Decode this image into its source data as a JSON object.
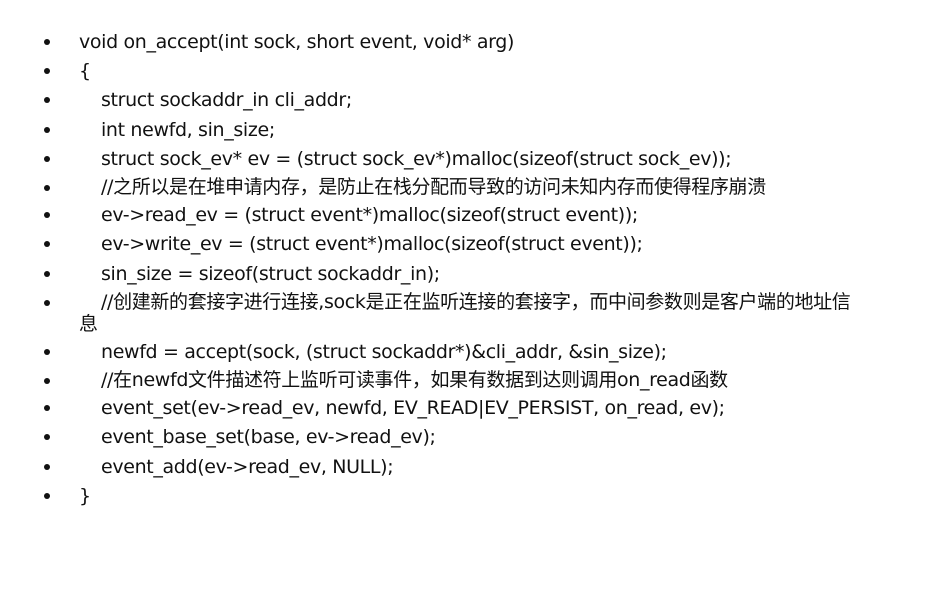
{
  "code_lines": [
    {
      "text": "void on_accept(int sock, short event, void* arg)",
      "indent": false,
      "wrap": false
    },
    {
      "text": "{",
      "indent": false,
      "wrap": false
    },
    {
      "text": "struct sockaddr_in cli_addr;",
      "indent": true,
      "wrap": false
    },
    {
      "text": "int newfd, sin_size;",
      "indent": true,
      "wrap": false
    },
    {
      "text": "struct sock_ev* ev = (struct sock_ev*)malloc(sizeof(struct sock_ev));",
      "indent": true,
      "wrap": false
    },
    {
      "text": "//之所以是在堆申请内存，是防止在栈分配而导致的访问未知内存而使得程序崩溃",
      "indent": true,
      "wrap": true
    },
    {
      "text": "ev->read_ev = (struct event*)malloc(sizeof(struct event));",
      "indent": true,
      "wrap": false
    },
    {
      "text": "ev->write_ev = (struct event*)malloc(sizeof(struct event));",
      "indent": true,
      "wrap": false
    },
    {
      "text": "sin_size = sizeof(struct sockaddr_in);",
      "indent": true,
      "wrap": false
    },
    {
      "text": "//创建新的套接字进行连接,sock是正在监听连接的套接字，而中间参数则是客户端的地址信息",
      "indent": true,
      "wrap": true
    },
    {
      "text": "newfd = accept(sock, (struct sockaddr*)&cli_addr, &sin_size);",
      "indent": true,
      "wrap": false
    },
    {
      "text": "//在newfd文件描述符上监听可读事件，如果有数据到达则调用on_read函数",
      "indent": true,
      "wrap": true
    },
    {
      "text": "event_set(ev->read_ev, newfd, EV_READ|EV_PERSIST, on_read, ev);",
      "indent": true,
      "wrap": false
    },
    {
      "text": "event_base_set(base, ev->read_ev);",
      "indent": true,
      "wrap": false
    },
    {
      "text": "event_add(ev->read_ev, NULL);",
      "indent": true,
      "wrap": false
    },
    {
      "text": "}",
      "indent": false,
      "wrap": false
    }
  ]
}
